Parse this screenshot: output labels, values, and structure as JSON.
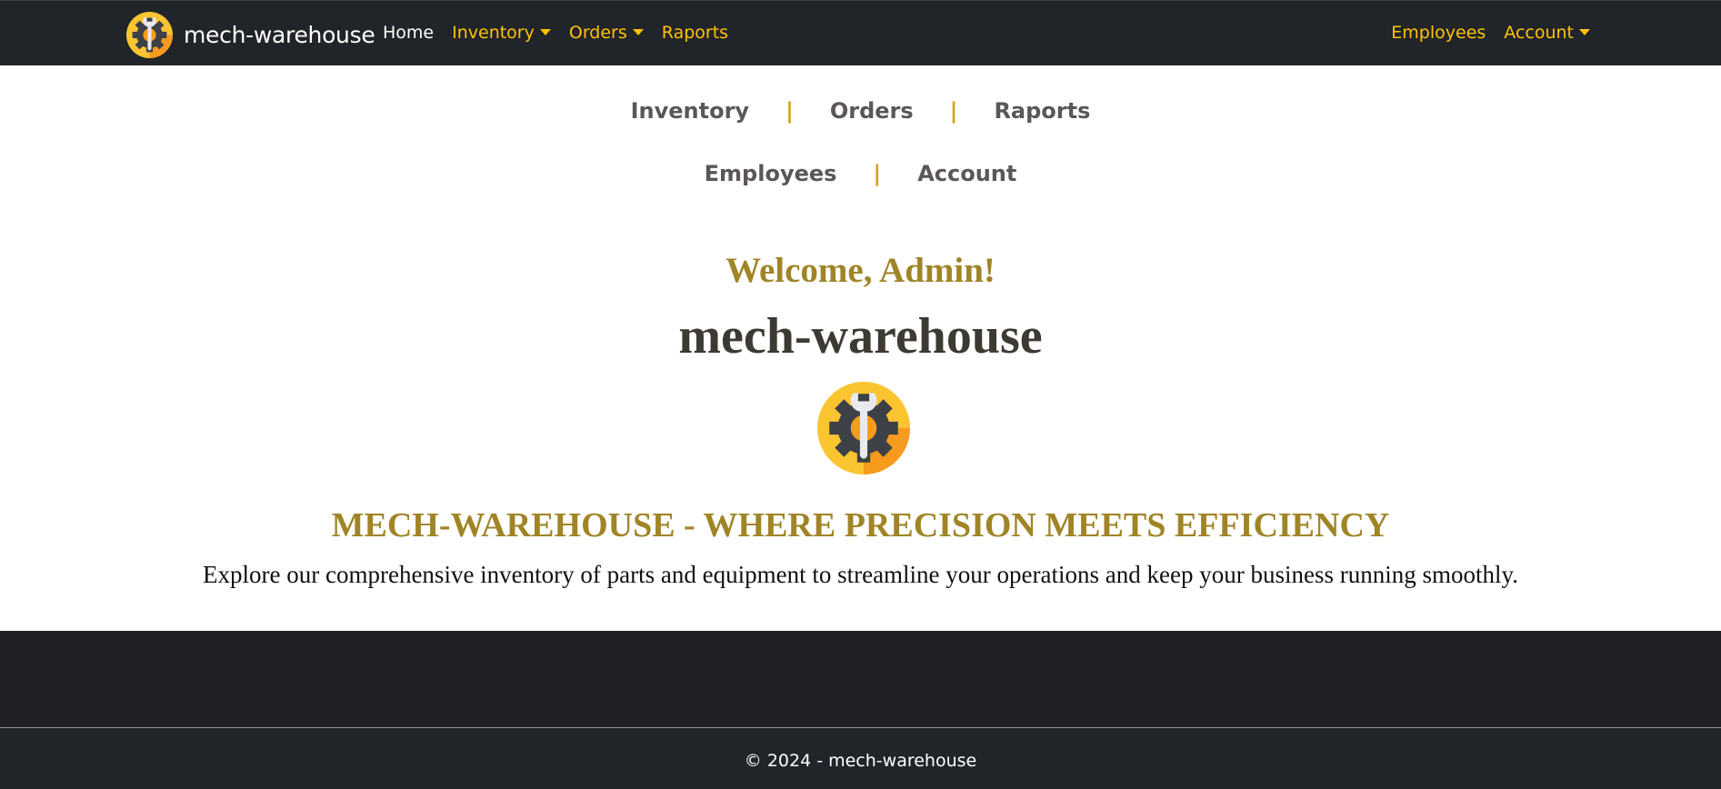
{
  "navbar": {
    "brand": "mech-warehouse",
    "brand_logo_icon": "gear-wrench-icon",
    "left_items": [
      {
        "label": "Home",
        "active": true,
        "dropdown": false
      },
      {
        "label": "Inventory",
        "active": false,
        "dropdown": true
      },
      {
        "label": "Orders",
        "active": false,
        "dropdown": true
      },
      {
        "label": "Raports",
        "active": false,
        "dropdown": false
      }
    ],
    "right_items": [
      {
        "label": "Employees",
        "dropdown": false
      },
      {
        "label": "Account",
        "dropdown": true
      }
    ]
  },
  "quick_links": {
    "row1": [
      "Inventory",
      "Orders",
      "Raports"
    ],
    "row2": [
      "Employees",
      "Account"
    ],
    "separator": "|"
  },
  "hero": {
    "welcome": "Welcome, Admin!",
    "title": "mech-warehouse",
    "logo_icon": "gear-wrench-icon",
    "tagline": "MECH-WAREHOUSE - WHERE PRECISION MEETS EFFICIENCY",
    "description": "Explore our comprehensive inventory of parts and equipment to streamline your operations and keep your business running smoothly."
  },
  "footer": {
    "text": "© 2024 - mech-warehouse"
  },
  "colors": {
    "navbar_bg": "#212529",
    "nav_link": "#ffc107",
    "accent_gold": "#a08527",
    "separator": "#d4a21f",
    "footer_bg": "#212529"
  }
}
